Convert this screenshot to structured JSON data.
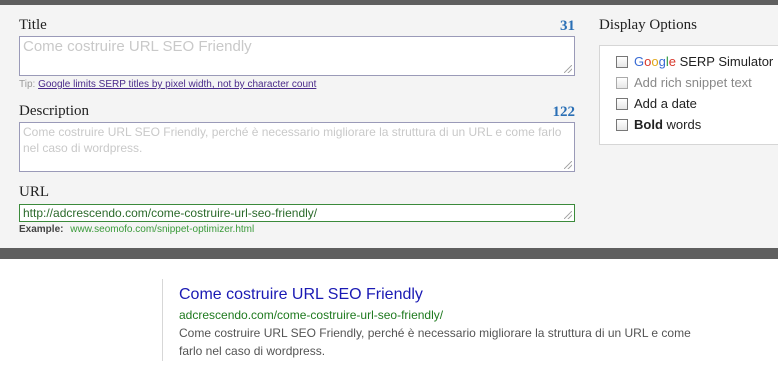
{
  "form": {
    "title": {
      "label": "Title",
      "counter": "31",
      "value": "Come costruire URL SEO Friendly",
      "tip_prefix": "Tip:",
      "tip_link": "Google limits SERP titles by pixel width, not by character count"
    },
    "description": {
      "label": "Description",
      "counter": "122",
      "value": "Come costruire URL SEO Friendly, perché è necessario migliorare la struttura di un URL e come farlo nel caso di wordpress."
    },
    "url": {
      "label": "URL",
      "value": "http://adcrescendo.com/come-costruire-url-seo-friendly/",
      "example_label": "Example:",
      "example_value": "www.seomofo.com/snippet-optimizer.html"
    }
  },
  "display_options": {
    "title": "Display Options",
    "items": [
      {
        "google_letters": [
          "G",
          "o",
          "o",
          "g",
          "l",
          "e"
        ],
        "label": "SERP Simulator",
        "enabled": true
      },
      {
        "label": "Add rich snippet text",
        "enabled": false
      },
      {
        "label": "Add a date",
        "enabled": true
      },
      {
        "bold": "Bold",
        "label": "words",
        "enabled": true
      }
    ]
  },
  "preview": {
    "title": "Come costruire URL SEO Friendly",
    "url": "adcrescendo.com/come-costruire-url-seo-friendly/",
    "description": "Come costruire URL SEO Friendly, perché è necessario migliorare la struttura di un URL e come farlo nel caso di wordpress."
  },
  "colors": {
    "bar": "#5f5f5f",
    "panel": "#f4f4f4",
    "counter": "#2a6fb5",
    "preview_title": "#1a1ab4",
    "preview_url": "#1f7a1f"
  }
}
